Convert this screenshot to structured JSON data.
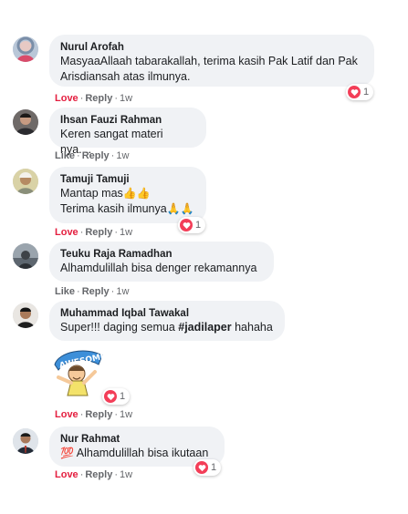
{
  "comments": [
    {
      "author": "Nurul Arofah",
      "lines": [
        "MasyaaAllaah tabarakallah, terima kasih Pak Latif dan Pak",
        "Arisdiansah atas ilmunya."
      ],
      "reaction": "Love",
      "reply": "Reply",
      "time": "1w",
      "reaction_count": "1"
    },
    {
      "author": "Ihsan Fauzi Rahman",
      "lines": [
        "Keren sangat materi nya...."
      ],
      "reaction": "Like",
      "reply": "Reply",
      "time": "1w"
    },
    {
      "author": "Tamuji Tamuji",
      "lines": [
        "Mantap mas",
        "Terima kasih ilmunya"
      ],
      "emoji_line1": "👍👍",
      "emoji_line2": "🙏🙏",
      "reaction": "Love",
      "reply": "Reply",
      "time": "1w",
      "reaction_count": "1"
    },
    {
      "author": "Teuku Raja Ramadhan",
      "lines": [
        "Alhamdulillah bisa denger rekamannya"
      ],
      "reaction": "Like",
      "reply": "Reply",
      "time": "1w"
    },
    {
      "author": "Muhammad Iqbal Tawakal",
      "text_before": "Super!!! daging semua ",
      "hashtag": "#jadilaper",
      "text_after": " hahaha",
      "sticker_text": "AWESOME",
      "reaction": "Love",
      "reply": "Reply",
      "time": "1w",
      "reaction_count": "1"
    },
    {
      "author": "Nur Rahmat",
      "emoji": "💯",
      "lines": [
        "Alhamdulillah bisa ikutaan"
      ],
      "reaction": "Love",
      "reply": "Reply",
      "time": "1w",
      "reaction_count": "1"
    }
  ],
  "separator": "·",
  "colors": {
    "love": "#e41e3f",
    "bubble": "#f0f2f5",
    "meta": "#65676b",
    "heart": "#f33e58"
  }
}
